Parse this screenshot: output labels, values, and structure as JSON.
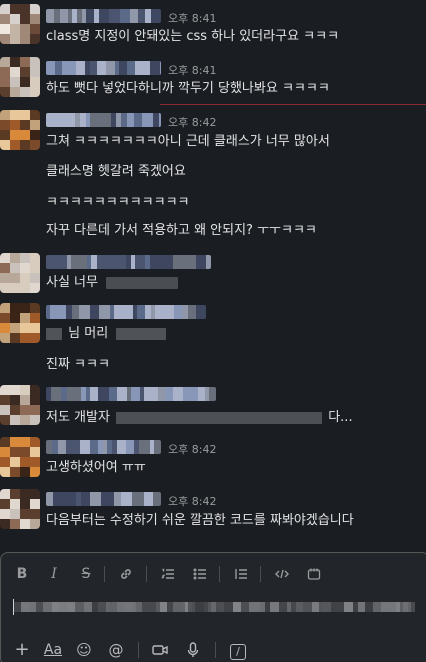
{
  "messages": [
    {
      "time": "오후 8:41",
      "lines": [
        "class명 지정이 안돼있는 css 하나 있더라구요 ㅋㅋㅋ"
      ]
    },
    {
      "time": "오후 8:41",
      "lines": [
        "하도 뻣다 넣었다하니까 깍두기 당했나봐요 ㅋㅋㅋㅋ"
      ]
    },
    {
      "time": "오후 8:42",
      "lines": [
        "그쳐 ㅋㅋㅋㅋㅋㅋㅋ아니 근데 클래스가 너무 많아서",
        "클래스명 헷갈려 죽겠어요",
        "ㅋㅋㅋㅋㅋㅋㅋㅋㅋㅋㅋㅋ",
        "자꾸 다른데 가서 적용하고 왜 안되지? ㅜㅜㅋㅋㅋ"
      ]
    },
    {
      "time": "",
      "lines": [
        "사실 너무"
      ]
    },
    {
      "time": "",
      "lines": [
        "님 머리",
        "진짜 ㅋㅋㅋ"
      ]
    },
    {
      "time": "",
      "lines": [
        "저도 개발자",
        "다..."
      ]
    },
    {
      "time": "오후 8:42",
      "lines": [
        "고생하셨어여 ㅠㅠ"
      ]
    },
    {
      "time": "오후 8:42",
      "lines": [
        "다음부터는 수정하기 쉬운 깔끔한 코드를 짜봐야겠습니다"
      ]
    }
  ],
  "composer": {
    "toolbar_icons": [
      "bold-icon",
      "italic-icon",
      "strikethrough-icon",
      "link-icon",
      "ordered-list-icon",
      "bulleted-list-icon",
      "blockquote-icon",
      "code-icon",
      "code-block-icon"
    ],
    "toolbar_glyphs": {
      "bold": "B",
      "italic": "I",
      "strike": "S"
    },
    "bottom_icons": [
      "plus-icon",
      "formatting-icon",
      "emoji-icon",
      "mention-icon",
      "video-icon",
      "microphone-icon",
      "slash-shortcut-icon"
    ],
    "bottom_glyphs": {
      "plus": "+",
      "format": "Aa",
      "emoji": "☺",
      "mention": "@",
      "slash": "/"
    }
  },
  "colors": {
    "background": "#1a1d21",
    "unread_divider": "#8b2a35",
    "text": "#e3e4e5",
    "muted": "#9b9c9e"
  }
}
